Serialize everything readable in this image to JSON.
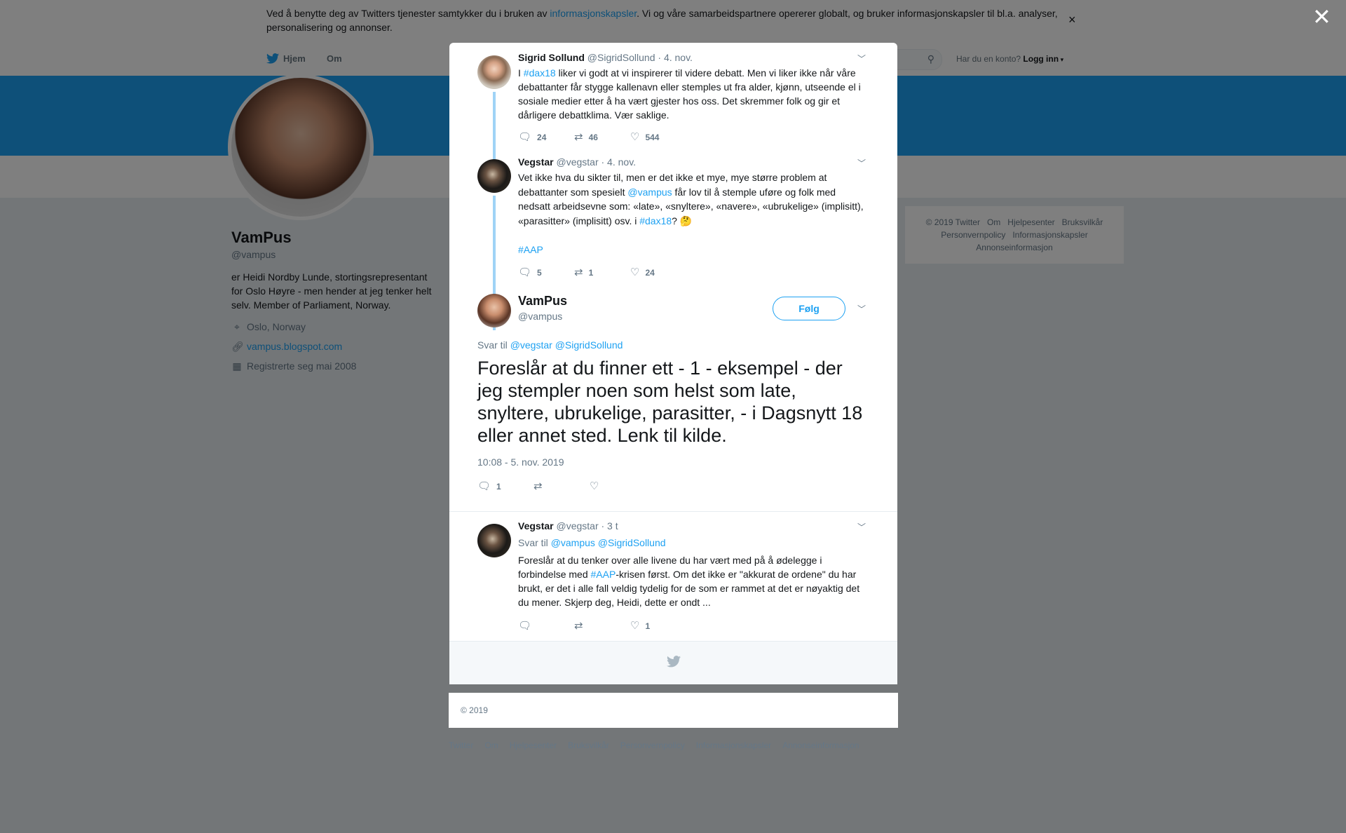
{
  "cookie": {
    "text_before": "Ved å benytte deg av Twitters tjenester samtykker du i bruken av ",
    "link": "informasjonskapsler",
    "text_after": ". Vi og våre samarbeidspartnere opererer globalt, og bruker informasjonskapsler til bl.a. analyser, personalisering og annonser.",
    "close": "×"
  },
  "nav": {
    "home": "Hjem",
    "about": "Om",
    "login_question": "Har du en konto?",
    "login": "Logg inn"
  },
  "profile": {
    "name": "VamPus",
    "handle": "@vampus",
    "bio": "er Heidi Nordby Lunde, stortingsrepresentant for Oslo Høyre - men hender at jeg tenker helt selv. Member of Parliament, Norway.",
    "location": "Oslo, Norway",
    "url": "vampus.blogspot.com",
    "joined": "Registrerte seg mai 2008"
  },
  "side_footer": [
    "© 2019 Twitter",
    "Om",
    "Hjelpesenter",
    "Bruksvilkår",
    "Personvernpolicy",
    "Informasjonskapsler",
    "Annonseinformasjon"
  ],
  "overlay_close": "✕",
  "tweets": [
    {
      "name": "Sigrid Sollund",
      "handle": "@SigridSollund",
      "time": "· 4. nov.",
      "t1": "I ",
      "tag1": "#dax18",
      "t2": " liker vi godt at vi inspirerer til videre debatt. Men vi liker ikke når våre debattanter får stygge kallenavn eller stemples ut fra alder, kjønn, utseende el i sosiale medier etter å ha vært gjester hos oss. Det skremmer folk og gir et dårligere debattklima. Vær saklige.",
      "replies": "24",
      "retweets": "46",
      "likes": "544"
    },
    {
      "name": "Vegstar",
      "handle": "@vegstar",
      "time": "· 4. nov.",
      "t1": "Vet ikke hva du sikter til, men er det ikke et mye, mye større problem at debattanter som spesielt ",
      "mention": "@vampus",
      "t2": " får lov til å stemple uføre og folk med nedsatt arbeidsevne som: «late», «snyltere», «navere», «ubrukelige» (implisitt), «parasitter» (implisitt) osv. i ",
      "tag1": "#dax18",
      "t3": "? 🤔",
      "tag2": "#AAP",
      "replies": "5",
      "retweets": "1",
      "likes": "24"
    },
    {
      "name": "Vegstar",
      "handle": "@vegstar",
      "time": "· 3 t",
      "reply_label": "Svar til",
      "reply_m1": "@vampus",
      "reply_m2": "@SigridSollund",
      "t1": "Foreslår at du tenker over alle livene du har vært med på å ødelegge i forbindelse med ",
      "tag1": "#AAP",
      "t2": "-krisen først. Om det ikke er \"akkurat de ordene\" du har brukt, er det i alle fall veldig tydelig for de som er rammet at det er nøyaktig det du mener. Skjerp deg, Heidi, dette er ondt ...",
      "likes": "1"
    }
  ],
  "main_tweet": {
    "name": "VamPus",
    "handle": "@vampus",
    "follow": "Følg",
    "reply_label": "Svar til",
    "reply_m1": "@vegstar",
    "reply_m2": "@SigridSollund",
    "text": "Foreslår at du finner ett - 1 - eksempel - der jeg stempler noen som helst som late, snyltere, ubrukelige, parasitter,  - i Dagsnytt 18 eller annet sted. Lenk til kilde.",
    "timestamp": "10:08 - 5. nov. 2019",
    "replies": "1"
  },
  "bottom_footer": [
    "© 2019 Twitter",
    "Om",
    "Hjelpesenter",
    "Bruksvilkår",
    "Personvernpolicy",
    "Informasjonskapsler",
    "Annonseinformasjon"
  ],
  "icons": {
    "reply": "speech-bubble",
    "retweet": "retweet-arrows",
    "like": "heart",
    "bird": "twitter-bird"
  },
  "colors": {
    "accent": "#1da1f2",
    "overlay": "rgba(0,0,0,0.5)"
  }
}
